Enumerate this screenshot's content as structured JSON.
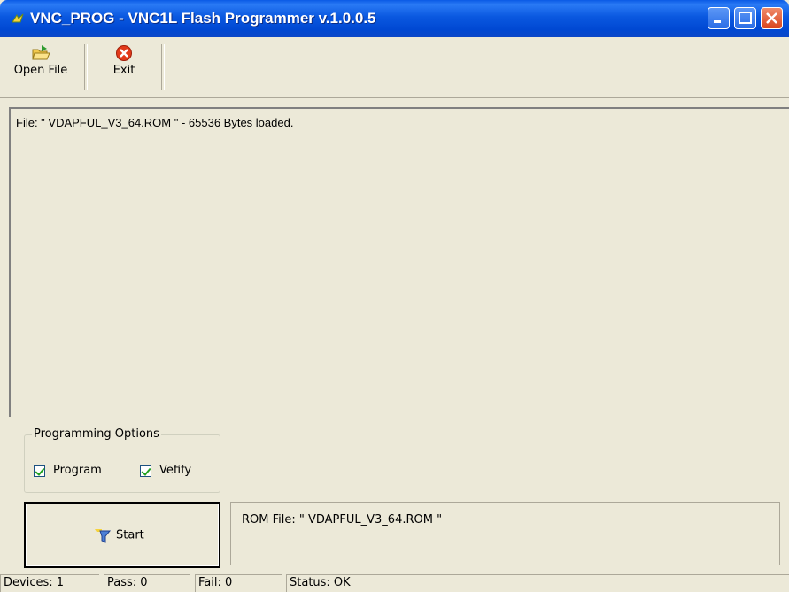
{
  "window": {
    "title": "VNC_PROG - VNC1L Flash Programmer v.1.0.0.5",
    "icon": "app-icon",
    "controls": [
      "minimize-icon",
      "maximize-icon",
      "close-icon"
    ]
  },
  "toolbar": {
    "open_file_label": "Open File",
    "exit_label": "Exit"
  },
  "log": {
    "line1": "File: \" VDAPFUL_V3_64.ROM \" - 65536 Bytes loaded."
  },
  "options": {
    "group_label": "Programming Options",
    "program_label": "Program",
    "program_checked": true,
    "verify_label": "Vefify",
    "verify_checked": true
  },
  "actions": {
    "start_label": "Start"
  },
  "rom_panel": {
    "text": "ROM File: \" VDAPFUL_V3_64.ROM \""
  },
  "status": {
    "devices": "Devices: 1",
    "pass": "Pass: 0",
    "fail": "Fail: 0",
    "status": "Status: OK"
  },
  "colors": {
    "titlebar": "#0a58e0",
    "window_bg": "#ece9d8",
    "check_mark": "#21a121"
  }
}
